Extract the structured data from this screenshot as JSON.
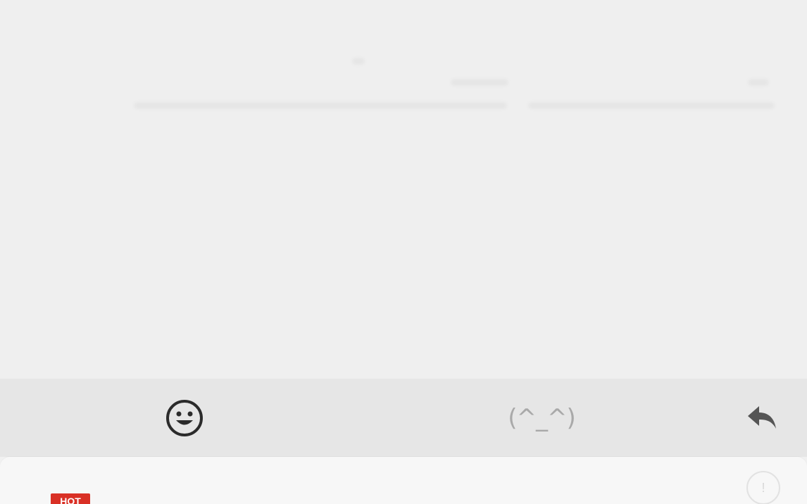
{
  "toolbar": {
    "emoji_icon": "smiley-face-icon",
    "kaomoji_label": "(^_^)",
    "back_icon": "reply-arrow-icon"
  },
  "panel": {
    "badge_label": "HOT",
    "info_label": "!"
  },
  "colors": {
    "background": "#f1f1f1",
    "toolbar": "#e6e6e6",
    "badge": "#d93025",
    "icon_dark": "#2b2b2b",
    "icon_muted": "#a9a9a9"
  }
}
